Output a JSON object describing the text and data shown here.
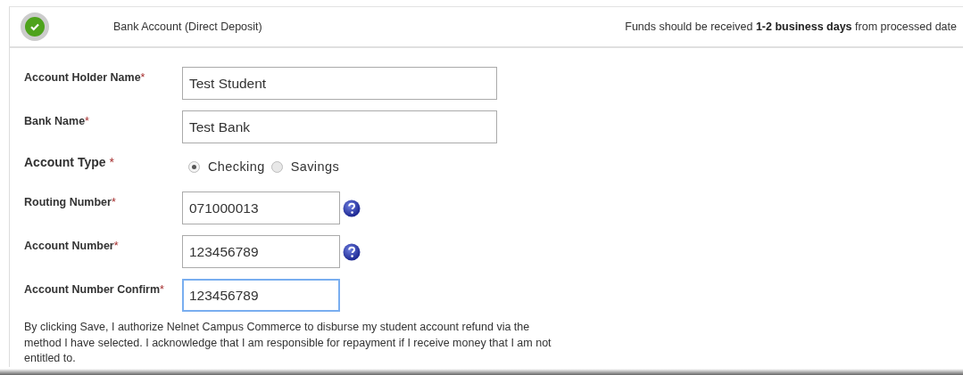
{
  "header": {
    "completed": true,
    "title": "Bank Account (Direct Deposit)",
    "note": "Funds should be received **1-2 business days** from processed date"
  },
  "fields": [
    {
      "kind": "text",
      "label": "Account Holder Name",
      "marker": "*",
      "value": "Test Student",
      "help": false,
      "focused": false
    },
    {
      "kind": "text",
      "label": "Bank Name",
      "marker": "*",
      "value": "Test Bank",
      "help": false,
      "focused": false
    },
    {
      "kind": "radio",
      "label": "Account Type ",
      "marker": "*",
      "options": [
        {
          "label": "Checking",
          "selected": true
        },
        {
          "label": "Savings",
          "selected": false
        }
      ]
    },
    {
      "kind": "number",
      "label": "Routing Number",
      "marker": "*",
      "value": "071000013",
      "help": true,
      "focused": false
    },
    {
      "kind": "number",
      "label": "Account Number",
      "marker": "*",
      "value": "123456789",
      "help": true,
      "focused": false
    },
    {
      "kind": "number",
      "label": "Account Number Confirm",
      "marker": "*",
      "value": "123456789",
      "help": false,
      "focused": true
    }
  ],
  "authorization": "By clicking Save, I authorize Nelnet Campus Commerce to disburse my student account refund via the method I have selected. I acknowledge that I am responsible for repayment if I receive money that I am not entitled to."
}
